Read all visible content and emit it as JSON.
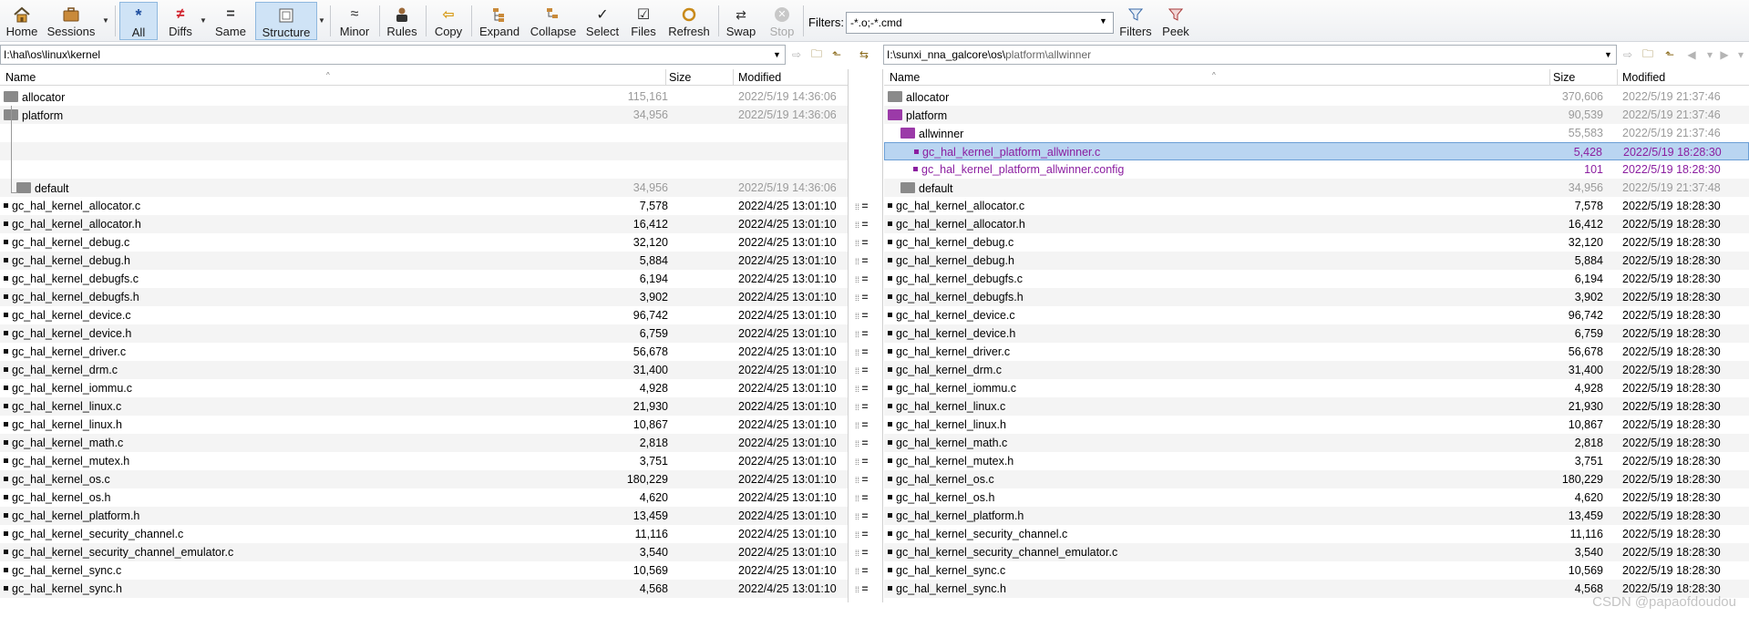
{
  "toolbar": {
    "home": "Home",
    "sessions": "Sessions",
    "all": "All",
    "diffs": "Diffs",
    "same": "Same",
    "structure": "Structure",
    "minor": "Minor",
    "rules": "Rules",
    "copy": "Copy",
    "expand": "Expand",
    "collapse": "Collapse",
    "select": "Select",
    "files": "Files",
    "refresh": "Refresh",
    "swap": "Swap",
    "stop": "Stop",
    "filters_label": "Filters:",
    "filter_value": "-*.o;-*.cmd",
    "filters_btn": "Filters",
    "peek": "Peek"
  },
  "left": {
    "path": "I:\\hal\\os\\linux\\kernel",
    "headers": {
      "name": "Name",
      "size": "Size",
      "modified": "Modified"
    },
    "rows": [
      {
        "name": "allocator",
        "size": "115,161",
        "date": "2022/5/19 14:36:06",
        "kind": "folder",
        "style": "gray"
      },
      {
        "name": "platform",
        "size": "34,956",
        "date": "2022/5/19 14:36:06",
        "kind": "folder",
        "style": "gray"
      },
      {
        "name": "",
        "size": "",
        "date": "",
        "kind": "blank"
      },
      {
        "name": "",
        "size": "",
        "date": "",
        "kind": "blank"
      },
      {
        "name": "",
        "size": "",
        "date": "",
        "kind": "blank"
      },
      {
        "name": "default",
        "size": "34,956",
        "date": "2022/5/19 14:36:06",
        "kind": "folder",
        "style": "gray",
        "indent": 1
      },
      {
        "name": "gc_hal_kernel_allocator.c",
        "size": "7,578",
        "date": "2022/4/25 13:01:10",
        "kind": "file"
      },
      {
        "name": "gc_hal_kernel_allocator.h",
        "size": "16,412",
        "date": "2022/4/25 13:01:10",
        "kind": "file"
      },
      {
        "name": "gc_hal_kernel_debug.c",
        "size": "32,120",
        "date": "2022/4/25 13:01:10",
        "kind": "file"
      },
      {
        "name": "gc_hal_kernel_debug.h",
        "size": "5,884",
        "date": "2022/4/25 13:01:10",
        "kind": "file"
      },
      {
        "name": "gc_hal_kernel_debugfs.c",
        "size": "6,194",
        "date": "2022/4/25 13:01:10",
        "kind": "file"
      },
      {
        "name": "gc_hal_kernel_debugfs.h",
        "size": "3,902",
        "date": "2022/4/25 13:01:10",
        "kind": "file"
      },
      {
        "name": "gc_hal_kernel_device.c",
        "size": "96,742",
        "date": "2022/4/25 13:01:10",
        "kind": "file"
      },
      {
        "name": "gc_hal_kernel_device.h",
        "size": "6,759",
        "date": "2022/4/25 13:01:10",
        "kind": "file"
      },
      {
        "name": "gc_hal_kernel_driver.c",
        "size": "56,678",
        "date": "2022/4/25 13:01:10",
        "kind": "file"
      },
      {
        "name": "gc_hal_kernel_drm.c",
        "size": "31,400",
        "date": "2022/4/25 13:01:10",
        "kind": "file"
      },
      {
        "name": "gc_hal_kernel_iommu.c",
        "size": "4,928",
        "date": "2022/4/25 13:01:10",
        "kind": "file"
      },
      {
        "name": "gc_hal_kernel_linux.c",
        "size": "21,930",
        "date": "2022/4/25 13:01:10",
        "kind": "file"
      },
      {
        "name": "gc_hal_kernel_linux.h",
        "size": "10,867",
        "date": "2022/4/25 13:01:10",
        "kind": "file"
      },
      {
        "name": "gc_hal_kernel_math.c",
        "size": "2,818",
        "date": "2022/4/25 13:01:10",
        "kind": "file"
      },
      {
        "name": "gc_hal_kernel_mutex.h",
        "size": "3,751",
        "date": "2022/4/25 13:01:10",
        "kind": "file"
      },
      {
        "name": "gc_hal_kernel_os.c",
        "size": "180,229",
        "date": "2022/4/25 13:01:10",
        "kind": "file"
      },
      {
        "name": "gc_hal_kernel_os.h",
        "size": "4,620",
        "date": "2022/4/25 13:01:10",
        "kind": "file"
      },
      {
        "name": "gc_hal_kernel_platform.h",
        "size": "13,459",
        "date": "2022/4/25 13:01:10",
        "kind": "file"
      },
      {
        "name": "gc_hal_kernel_security_channel.c",
        "size": "11,116",
        "date": "2022/4/25 13:01:10",
        "kind": "file"
      },
      {
        "name": "gc_hal_kernel_security_channel_emulator.c",
        "size": "3,540",
        "date": "2022/4/25 13:01:10",
        "kind": "file"
      },
      {
        "name": "gc_hal_kernel_sync.c",
        "size": "10,569",
        "date": "2022/4/25 13:01:10",
        "kind": "file"
      },
      {
        "name": "gc_hal_kernel_sync.h",
        "size": "4,568",
        "date": "2022/4/25 13:01:10",
        "kind": "file"
      }
    ]
  },
  "right": {
    "path_prefix": "I:\\sunxi_nna_galcore\\os\\",
    "path_suffix": "platform\\allwinner",
    "headers": {
      "name": "Name",
      "size": "Size",
      "modified": "Modified"
    },
    "rows": [
      {
        "name": "allocator",
        "size": "370,606",
        "date": "2022/5/19 21:37:46",
        "kind": "folder",
        "style": "gray"
      },
      {
        "name": "platform",
        "size": "90,539",
        "date": "2022/5/19 21:37:46",
        "kind": "folder",
        "style": "gray",
        "folder": "p"
      },
      {
        "name": "allwinner",
        "size": "55,583",
        "date": "2022/5/19 21:37:46",
        "kind": "folder",
        "style": "gray",
        "folder": "p",
        "indent": 1
      },
      {
        "name": "gc_hal_kernel_platform_allwinner.c",
        "size": "5,428",
        "date": "2022/5/19 18:28:30",
        "kind": "file",
        "style": "purple",
        "indent": 2,
        "selected": true
      },
      {
        "name": "gc_hal_kernel_platform_allwinner.config",
        "size": "101",
        "date": "2022/5/19 18:28:30",
        "kind": "file",
        "style": "purple",
        "indent": 2
      },
      {
        "name": "default",
        "size": "34,956",
        "date": "2022/5/19 21:37:48",
        "kind": "folder",
        "style": "gray",
        "indent": 1
      },
      {
        "name": "gc_hal_kernel_allocator.c",
        "size": "7,578",
        "date": "2022/5/19 18:28:30",
        "kind": "file"
      },
      {
        "name": "gc_hal_kernel_allocator.h",
        "size": "16,412",
        "date": "2022/5/19 18:28:30",
        "kind": "file"
      },
      {
        "name": "gc_hal_kernel_debug.c",
        "size": "32,120",
        "date": "2022/5/19 18:28:30",
        "kind": "file"
      },
      {
        "name": "gc_hal_kernel_debug.h",
        "size": "5,884",
        "date": "2022/5/19 18:28:30",
        "kind": "file"
      },
      {
        "name": "gc_hal_kernel_debugfs.c",
        "size": "6,194",
        "date": "2022/5/19 18:28:30",
        "kind": "file"
      },
      {
        "name": "gc_hal_kernel_debugfs.h",
        "size": "3,902",
        "date": "2022/5/19 18:28:30",
        "kind": "file"
      },
      {
        "name": "gc_hal_kernel_device.c",
        "size": "96,742",
        "date": "2022/5/19 18:28:30",
        "kind": "file"
      },
      {
        "name": "gc_hal_kernel_device.h",
        "size": "6,759",
        "date": "2022/5/19 18:28:30",
        "kind": "file"
      },
      {
        "name": "gc_hal_kernel_driver.c",
        "size": "56,678",
        "date": "2022/5/19 18:28:30",
        "kind": "file"
      },
      {
        "name": "gc_hal_kernel_drm.c",
        "size": "31,400",
        "date": "2022/5/19 18:28:30",
        "kind": "file"
      },
      {
        "name": "gc_hal_kernel_iommu.c",
        "size": "4,928",
        "date": "2022/5/19 18:28:30",
        "kind": "file"
      },
      {
        "name": "gc_hal_kernel_linux.c",
        "size": "21,930",
        "date": "2022/5/19 18:28:30",
        "kind": "file"
      },
      {
        "name": "gc_hal_kernel_linux.h",
        "size": "10,867",
        "date": "2022/5/19 18:28:30",
        "kind": "file"
      },
      {
        "name": "gc_hal_kernel_math.c",
        "size": "2,818",
        "date": "2022/5/19 18:28:30",
        "kind": "file"
      },
      {
        "name": "gc_hal_kernel_mutex.h",
        "size": "3,751",
        "date": "2022/5/19 18:28:30",
        "kind": "file"
      },
      {
        "name": "gc_hal_kernel_os.c",
        "size": "180,229",
        "date": "2022/5/19 18:28:30",
        "kind": "file"
      },
      {
        "name": "gc_hal_kernel_os.h",
        "size": "4,620",
        "date": "2022/5/19 18:28:30",
        "kind": "file"
      },
      {
        "name": "gc_hal_kernel_platform.h",
        "size": "13,459",
        "date": "2022/5/19 18:28:30",
        "kind": "file"
      },
      {
        "name": "gc_hal_kernel_security_channel.c",
        "size": "11,116",
        "date": "2022/5/19 18:28:30",
        "kind": "file"
      },
      {
        "name": "gc_hal_kernel_security_channel_emulator.c",
        "size": "3,540",
        "date": "2022/5/19 18:28:30",
        "kind": "file"
      },
      {
        "name": "gc_hal_kernel_sync.c",
        "size": "10,569",
        "date": "2022/5/19 18:28:30",
        "kind": "file"
      },
      {
        "name": "gc_hal_kernel_sync.h",
        "size": "4,568",
        "date": "2022/5/19 18:28:30",
        "kind": "file"
      }
    ]
  },
  "center_marker": "=",
  "watermark": "CSDN @papaofdoudou",
  "colors": {
    "selection": "#b9d5f1",
    "orphan_text": "#8b1ea0",
    "older_text": "#9b9b9b",
    "toolbar_active": "#cfe3f6"
  }
}
